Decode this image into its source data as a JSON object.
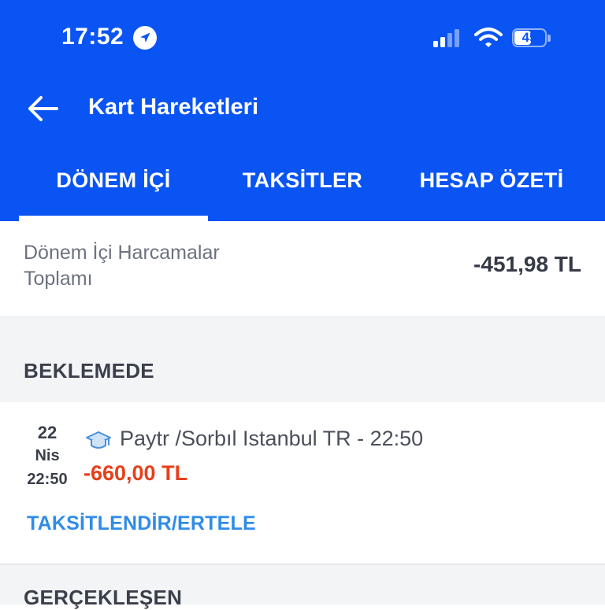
{
  "status_bar": {
    "time": "17:52",
    "battery_level": "45",
    "icons": [
      "location-arrow-icon",
      "cellular-signal-icon",
      "wifi-icon",
      "battery-icon"
    ]
  },
  "header": {
    "title": "Kart Hareketleri",
    "back_icon": "arrow-left-icon",
    "background_color": "#0a54f4"
  },
  "tabs": [
    {
      "label": "DÖNEM İÇİ",
      "active": true
    },
    {
      "label": "TAKSİTLER",
      "active": false
    },
    {
      "label": "HESAP ÖZETİ",
      "active": false
    }
  ],
  "summary": {
    "label": "Dönem İçi Harcamalar Toplamı",
    "value": "-451,98 TL"
  },
  "pending_section": {
    "title": "BEKLEMEDE",
    "transactions": [
      {
        "day": "22",
        "month": "Nis",
        "time": "22:50",
        "icon": "graduation-cap-icon",
        "description": "Paytr /Sorbıl Istanbul TR - 22:50",
        "amount": "-660,00 TL",
        "amount_color": "#e6401a",
        "action": "TAKSİTLENDİR/ERTELE"
      }
    ]
  },
  "completed_section": {
    "title": "GERÇEKLEŞEN"
  }
}
